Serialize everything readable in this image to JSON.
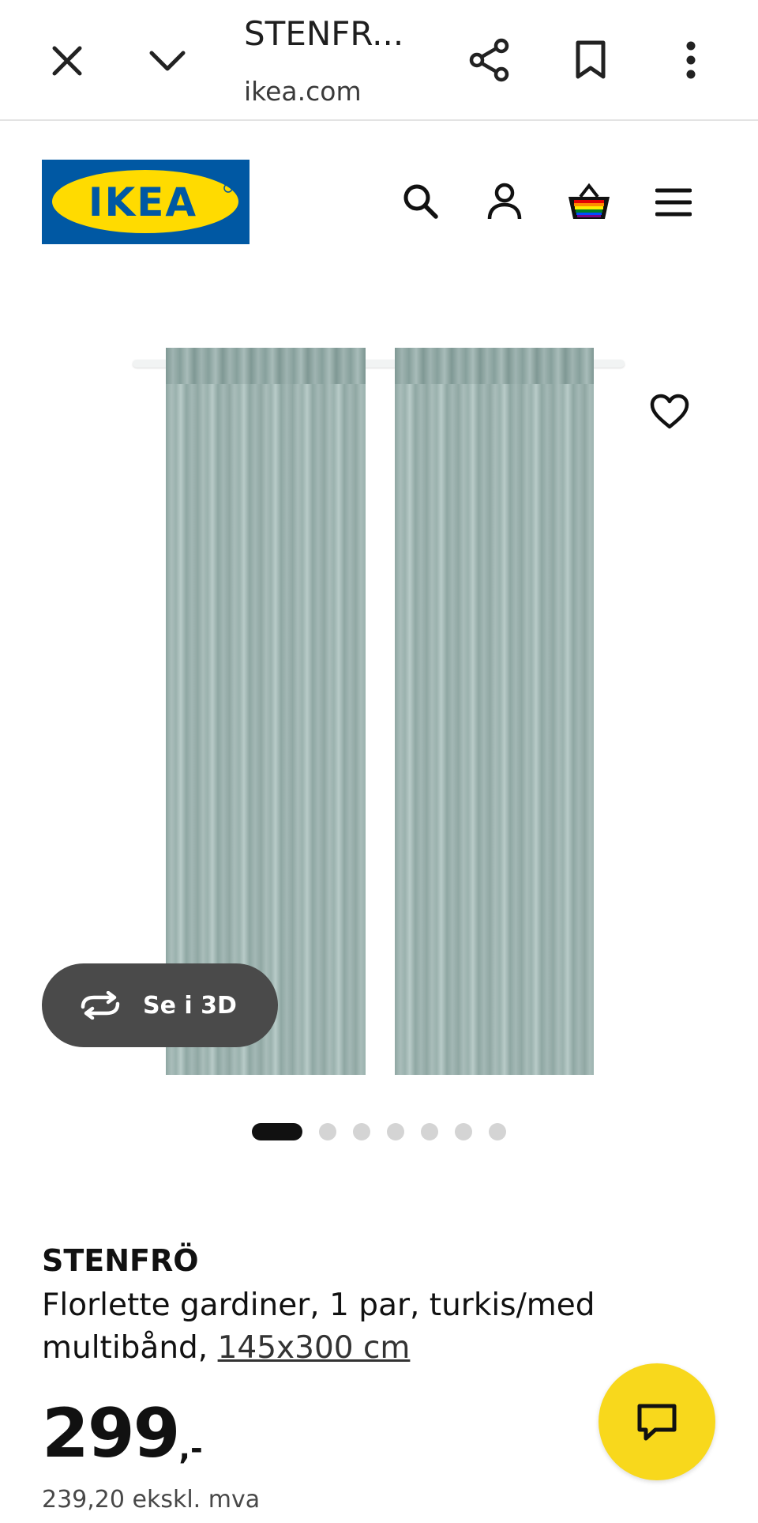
{
  "browser_bar": {
    "title": "STENFR...",
    "url": "ikea.com",
    "icons": [
      "close-icon",
      "chevron-down-icon",
      "share-icon",
      "bookmark-icon",
      "more-vert-icon"
    ]
  },
  "header": {
    "logo_text": "IKEA",
    "icons": [
      "search-icon",
      "account-icon",
      "basket-icon",
      "menu-icon"
    ]
  },
  "gallery": {
    "view_3d_label": "Se i 3D",
    "image_count": 7,
    "active_index": 0,
    "image_alt": "Curtains"
  },
  "product": {
    "name": "STENFRÖ",
    "description": "Florlette gardiner, 1 par, turkis/med multibånd,",
    "size": "145x300 cm",
    "price_main": "299",
    "price_suffix": ",-",
    "price_ex_vat": "239,20 ekskl. mva"
  },
  "colors": {
    "ikea_blue": "#0058a3",
    "ikea_yellow": "#ffdb00",
    "chat_yellow": "#f8d81c",
    "curtain": "#9bb2ae"
  }
}
